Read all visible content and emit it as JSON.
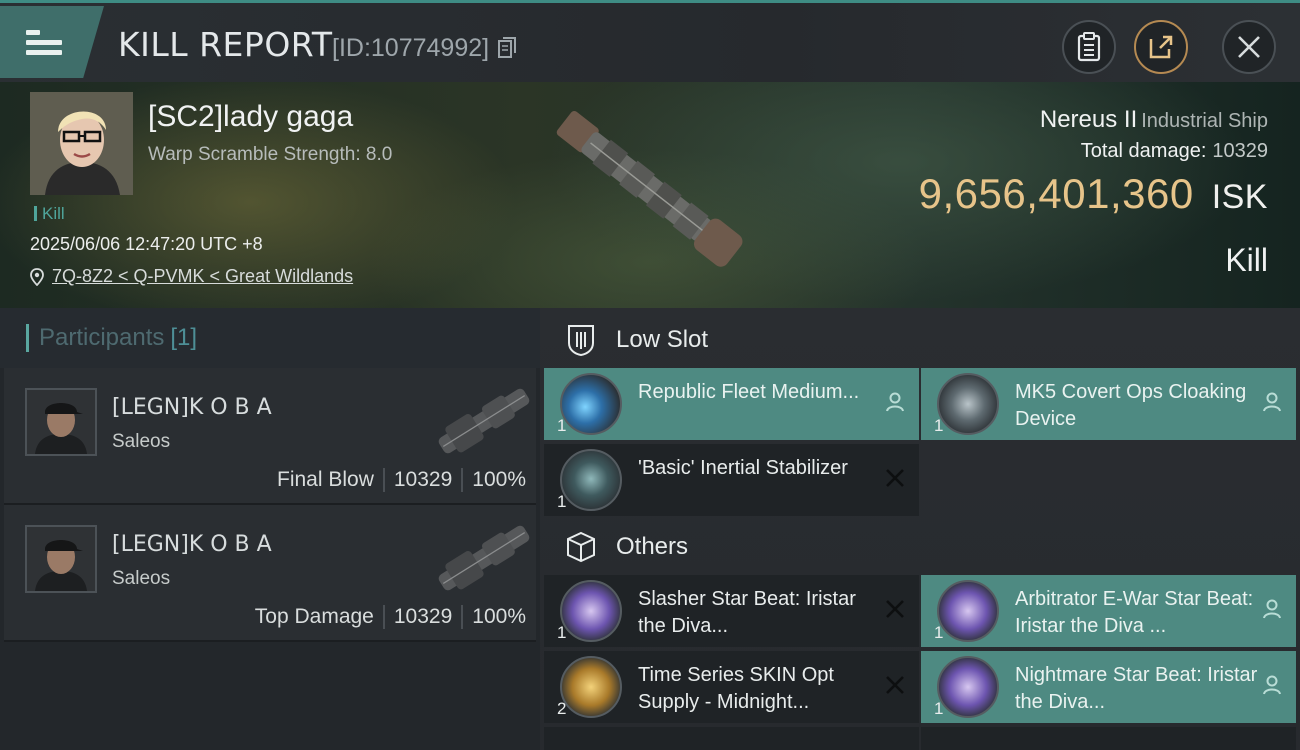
{
  "header": {
    "title": "KILL REPORT",
    "report_id": "[ID:10774992]"
  },
  "victim": {
    "name": "[SC2]lady gaga",
    "warp_scramble": "Warp Scramble Strength: 8.0",
    "tag": "Kill",
    "timestamp": "2025/06/06 12:47:20 UTC +8",
    "location": "7Q-8Z2 < Q-PVMK < Great Wildlands",
    "ship_name": "Nereus II",
    "ship_class": "Industrial Ship",
    "total_damage_label": "Total damage:",
    "total_damage_value": "10329",
    "isk_value": "9,656,401,360",
    "isk_unit": "ISK",
    "result": "Kill"
  },
  "participants": {
    "label": "Participants",
    "count": "[1]",
    "rows": [
      {
        "name": "[LEGN]K O B A",
        "ship": "Saleos",
        "role": "Final Blow",
        "damage": "10329",
        "percent": "100%"
      },
      {
        "name": "[LEGN]K O B A",
        "ship": "Saleos",
        "role": "Top Damage",
        "damage": "10329",
        "percent": "100%"
      }
    ]
  },
  "fitting": {
    "low_slot_label": "Low Slot",
    "others_label": "Others",
    "low_slot": [
      {
        "qty": "1",
        "name": "Republic Fleet Medium...",
        "state": "person"
      },
      {
        "qty": "1",
        "name": "MK5 Covert Ops Cloaking Device",
        "state": "person"
      },
      {
        "qty": "1",
        "name": "'Basic' Inertial Stabilizer",
        "state": "destroyed"
      }
    ],
    "others": [
      {
        "qty": "1",
        "name": "Slasher Star Beat: Iristar the Diva...",
        "state": "destroyed"
      },
      {
        "qty": "1",
        "name": "Arbitrator E-War Star Beat: Iristar the Diva ...",
        "state": "person"
      },
      {
        "qty": "2",
        "name": "Time Series SKIN Opt Supply - Midnight...",
        "state": "destroyed"
      },
      {
        "qty": "1",
        "name": "Nightmare Star Beat: Iristar the Diva...",
        "state": "person"
      }
    ]
  },
  "colors": {
    "accent_teal": "#4e8a82",
    "isk_gold": "#e7c48a",
    "background": "#1b1e22"
  }
}
